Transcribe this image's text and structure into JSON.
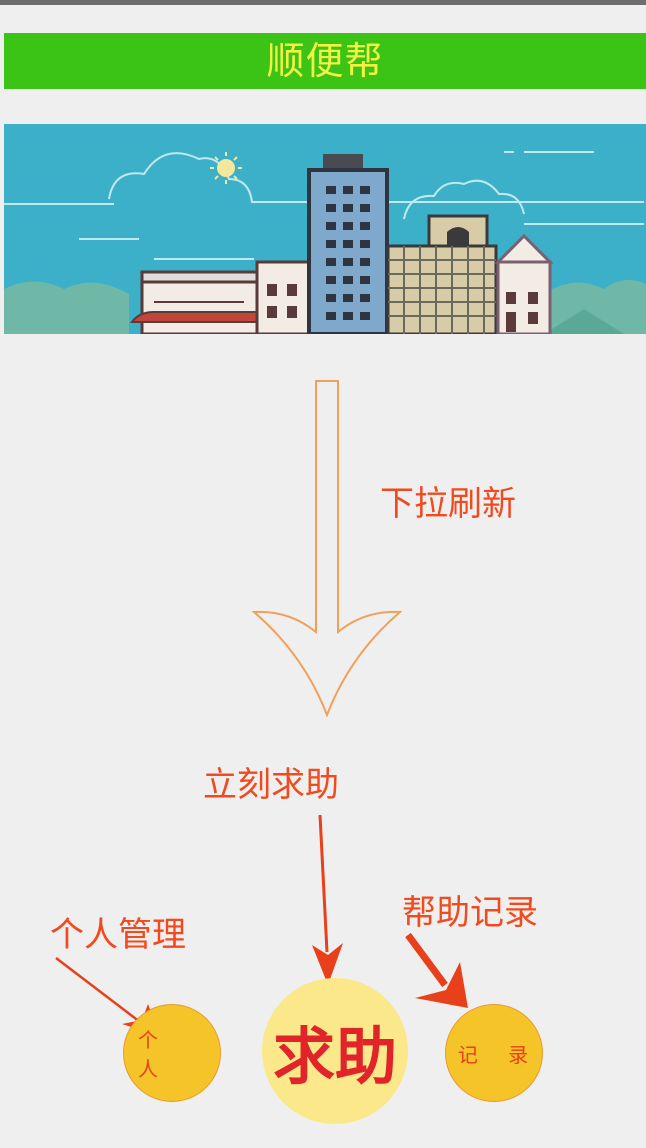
{
  "app": {
    "title": "顺便帮"
  },
  "banner": {
    "scene": "city-skyline-illustration"
  },
  "annotations": {
    "pull_refresh": "下拉刷新",
    "help_now": "立刻求助",
    "personal_mgmt": "个人管理",
    "help_records": "帮助记录"
  },
  "bottom_buttons": {
    "personal": "个 人",
    "help": "求助",
    "record": "记 录"
  },
  "colors": {
    "title_bg": "#3bc415",
    "title_text": "#f2f244",
    "annotation": "#f04a1e",
    "button_yellow": "#f5c428",
    "help_button": "#fbe88a",
    "help_text": "#e0242a"
  }
}
